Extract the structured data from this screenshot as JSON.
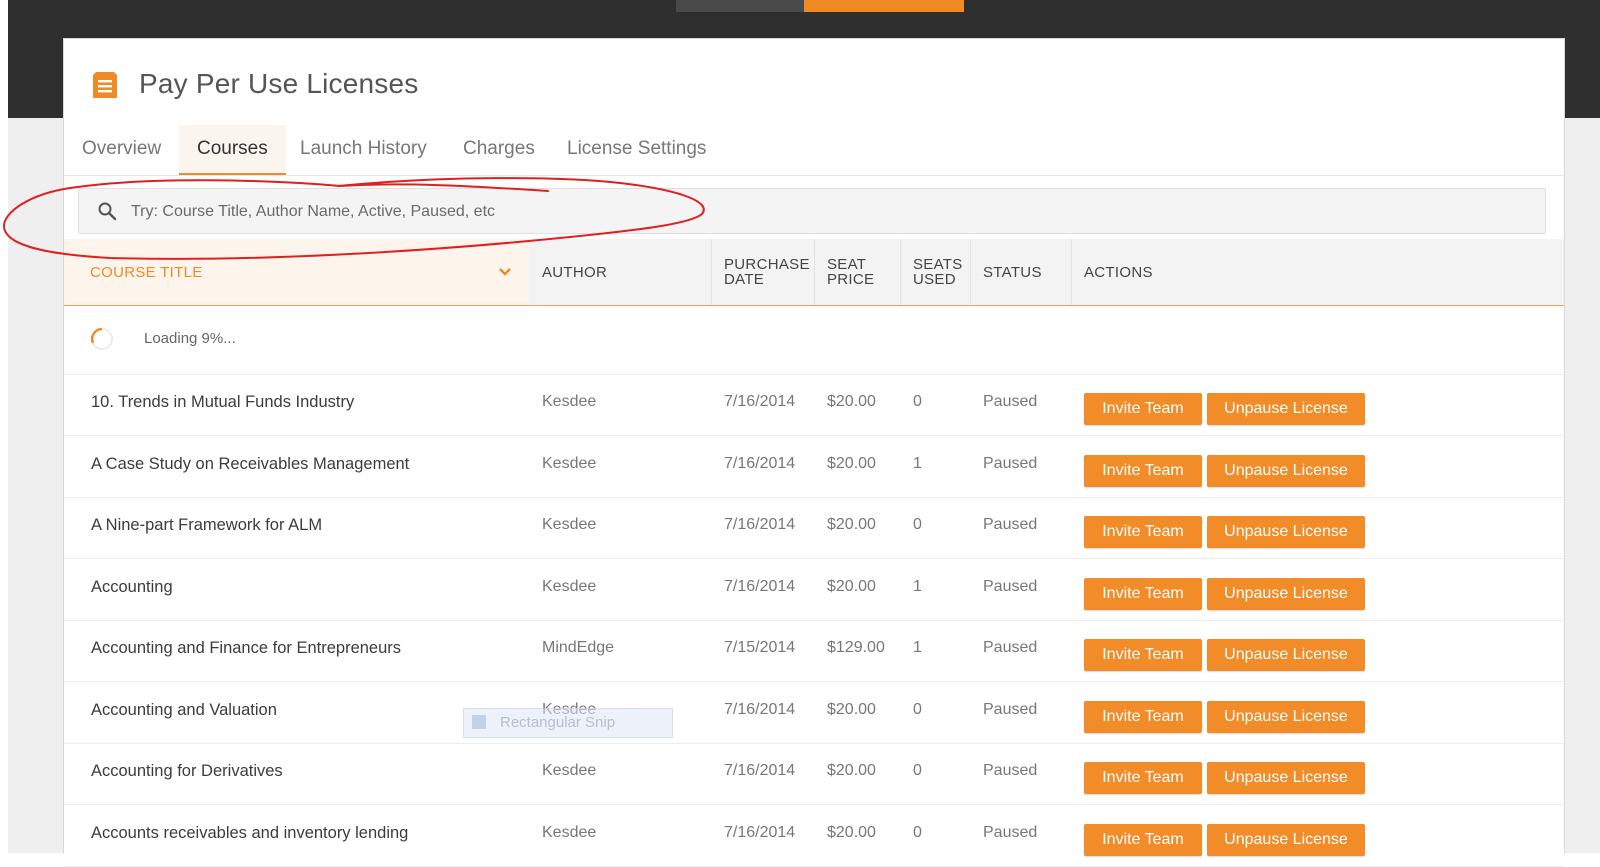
{
  "page_title": "Pay Per Use Licenses",
  "tabs": [
    {
      "label": "Overview",
      "active": false
    },
    {
      "label": "Courses",
      "active": true
    },
    {
      "label": "Launch History",
      "active": false
    },
    {
      "label": "Charges",
      "active": false
    },
    {
      "label": "License Settings",
      "active": false
    }
  ],
  "search": {
    "placeholder": "Try: Course Title, Author Name, Active, Paused, etc",
    "value": ""
  },
  "table": {
    "headers": {
      "course_title": "COURSE TITLE",
      "author": "AUTHOR",
      "purchase_date_1": "PURCHASE",
      "purchase_date_2": "DATE",
      "seat_price_1": "SEAT",
      "seat_price_2": "PRICE",
      "seats_used_1": "SEATS",
      "seats_used_2": "USED",
      "status": "STATUS",
      "actions": "ACTIONS"
    },
    "loading_text": "Loading 9%...",
    "rows": [
      {
        "title": "10. Trends in Mutual Funds Industry",
        "author": "Kesdee",
        "date": "7/16/2014",
        "price": "$20.00",
        "seats": "0",
        "status": "Paused"
      },
      {
        "title": "A Case Study on Receivables Management",
        "author": "Kesdee",
        "date": "7/16/2014",
        "price": "$20.00",
        "seats": "1",
        "status": "Paused"
      },
      {
        "title": "A Nine-part Framework for ALM",
        "author": "Kesdee",
        "date": "7/16/2014",
        "price": "$20.00",
        "seats": "0",
        "status": "Paused"
      },
      {
        "title": "Accounting",
        "author": "Kesdee",
        "date": "7/16/2014",
        "price": "$20.00",
        "seats": "1",
        "status": "Paused"
      },
      {
        "title": "Accounting and Finance for Entrepreneurs",
        "author": "MindEdge",
        "date": "7/15/2014",
        "price": "$129.00",
        "seats": "1",
        "status": "Paused"
      },
      {
        "title": "Accounting and Valuation",
        "author": "Kesdee",
        "date": "7/16/2014",
        "price": "$20.00",
        "seats": "0",
        "status": "Paused"
      },
      {
        "title": "Accounting for Derivatives",
        "author": "Kesdee",
        "date": "7/16/2014",
        "price": "$20.00",
        "seats": "0",
        "status": "Paused"
      },
      {
        "title": "Accounts receivables and inventory lending",
        "author": "Kesdee",
        "date": "7/16/2014",
        "price": "$20.00",
        "seats": "0",
        "status": "Paused"
      }
    ],
    "actions": {
      "invite_label": "Invite Team",
      "unpause_label": "Unpause License"
    }
  },
  "overlay": {
    "snip_text": "Rectangular Snip"
  },
  "icons": {
    "title": "license-list-icon",
    "search": "search-icon",
    "sort": "chevron-down-icon",
    "spinner": "loading-spinner-icon"
  },
  "colors": {
    "accent": "#f08a24",
    "button": "#f28c28",
    "annotation": "#e02020",
    "topbar": "#2f2f2f"
  }
}
